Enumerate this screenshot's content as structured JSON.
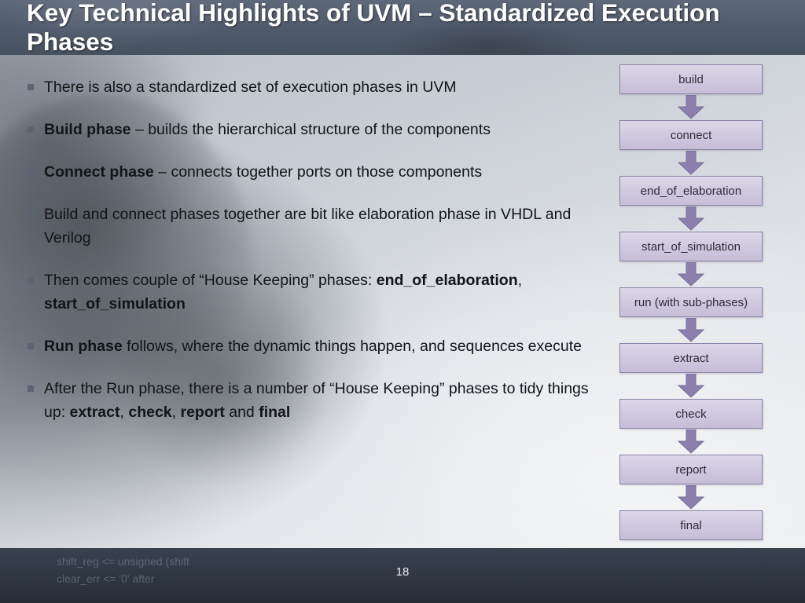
{
  "slide": {
    "title": "Key Technical Highlights of UVM – Standardized Execution Phases",
    "page_number": "18"
  },
  "bullets": [
    {
      "id": "bullet-1",
      "parts": [
        {
          "text": "There is also a standardized set of execution phases in UVM",
          "bold": false
        }
      ]
    },
    {
      "id": "bullet-2",
      "parts": [
        {
          "text": "Build phase",
          "bold": true
        },
        {
          "text": " – builds the hierarchical structure of the components",
          "bold": false
        }
      ]
    },
    {
      "id": "bullet-3",
      "parts": [
        {
          "text": "Connect phase",
          "bold": true
        },
        {
          "text": " – connects together ports on those components",
          "bold": false
        }
      ]
    },
    {
      "id": "bullet-4",
      "parts": [
        {
          "text": "Build and connect phases together are bit like elaboration phase in VHDL and Verilog",
          "bold": false
        }
      ]
    },
    {
      "id": "bullet-5",
      "parts": [
        {
          "text": "Then comes couple of “House Keeping” phases: ",
          "bold": false
        },
        {
          "text": "end_of_elaboration",
          "bold": true
        },
        {
          "text": ", ",
          "bold": false
        },
        {
          "text": "start_of_simulation",
          "bold": true
        }
      ]
    },
    {
      "id": "bullet-6",
      "parts": [
        {
          "text": "Run phase",
          "bold": true
        },
        {
          "text": " follows, where the dynamic things happen, and sequences execute",
          "bold": false
        }
      ]
    },
    {
      "id": "bullet-7",
      "parts": [
        {
          "text": "After the Run phase, there is a number of “House Keeping” phases to tidy things up: ",
          "bold": false
        },
        {
          "text": "extract",
          "bold": true
        },
        {
          "text": ", ",
          "bold": false
        },
        {
          "text": "check",
          "bold": true
        },
        {
          "text": ", ",
          "bold": false
        },
        {
          "text": "report",
          "bold": true
        },
        {
          "text": " and ",
          "bold": false
        },
        {
          "text": "final",
          "bold": true
        }
      ]
    }
  ],
  "flowchart": {
    "nodes": [
      "build",
      "connect",
      "end_of_elaboration",
      "start_of_simulation",
      "run (with sub-phases)",
      "extract",
      "check",
      "report",
      "final"
    ],
    "arrow_color": "#8c7fae",
    "node_fill": "#d3cce1"
  },
  "footer": {
    "code_line_1": "shift_reg <= unsigned (shift",
    "code_line_2": "clear_err <= '0' after"
  },
  "colors": {
    "title_band": "#515c6d",
    "footer_band": "#2f3743",
    "bullet_marker": "#5a6472",
    "text": "#111418"
  }
}
